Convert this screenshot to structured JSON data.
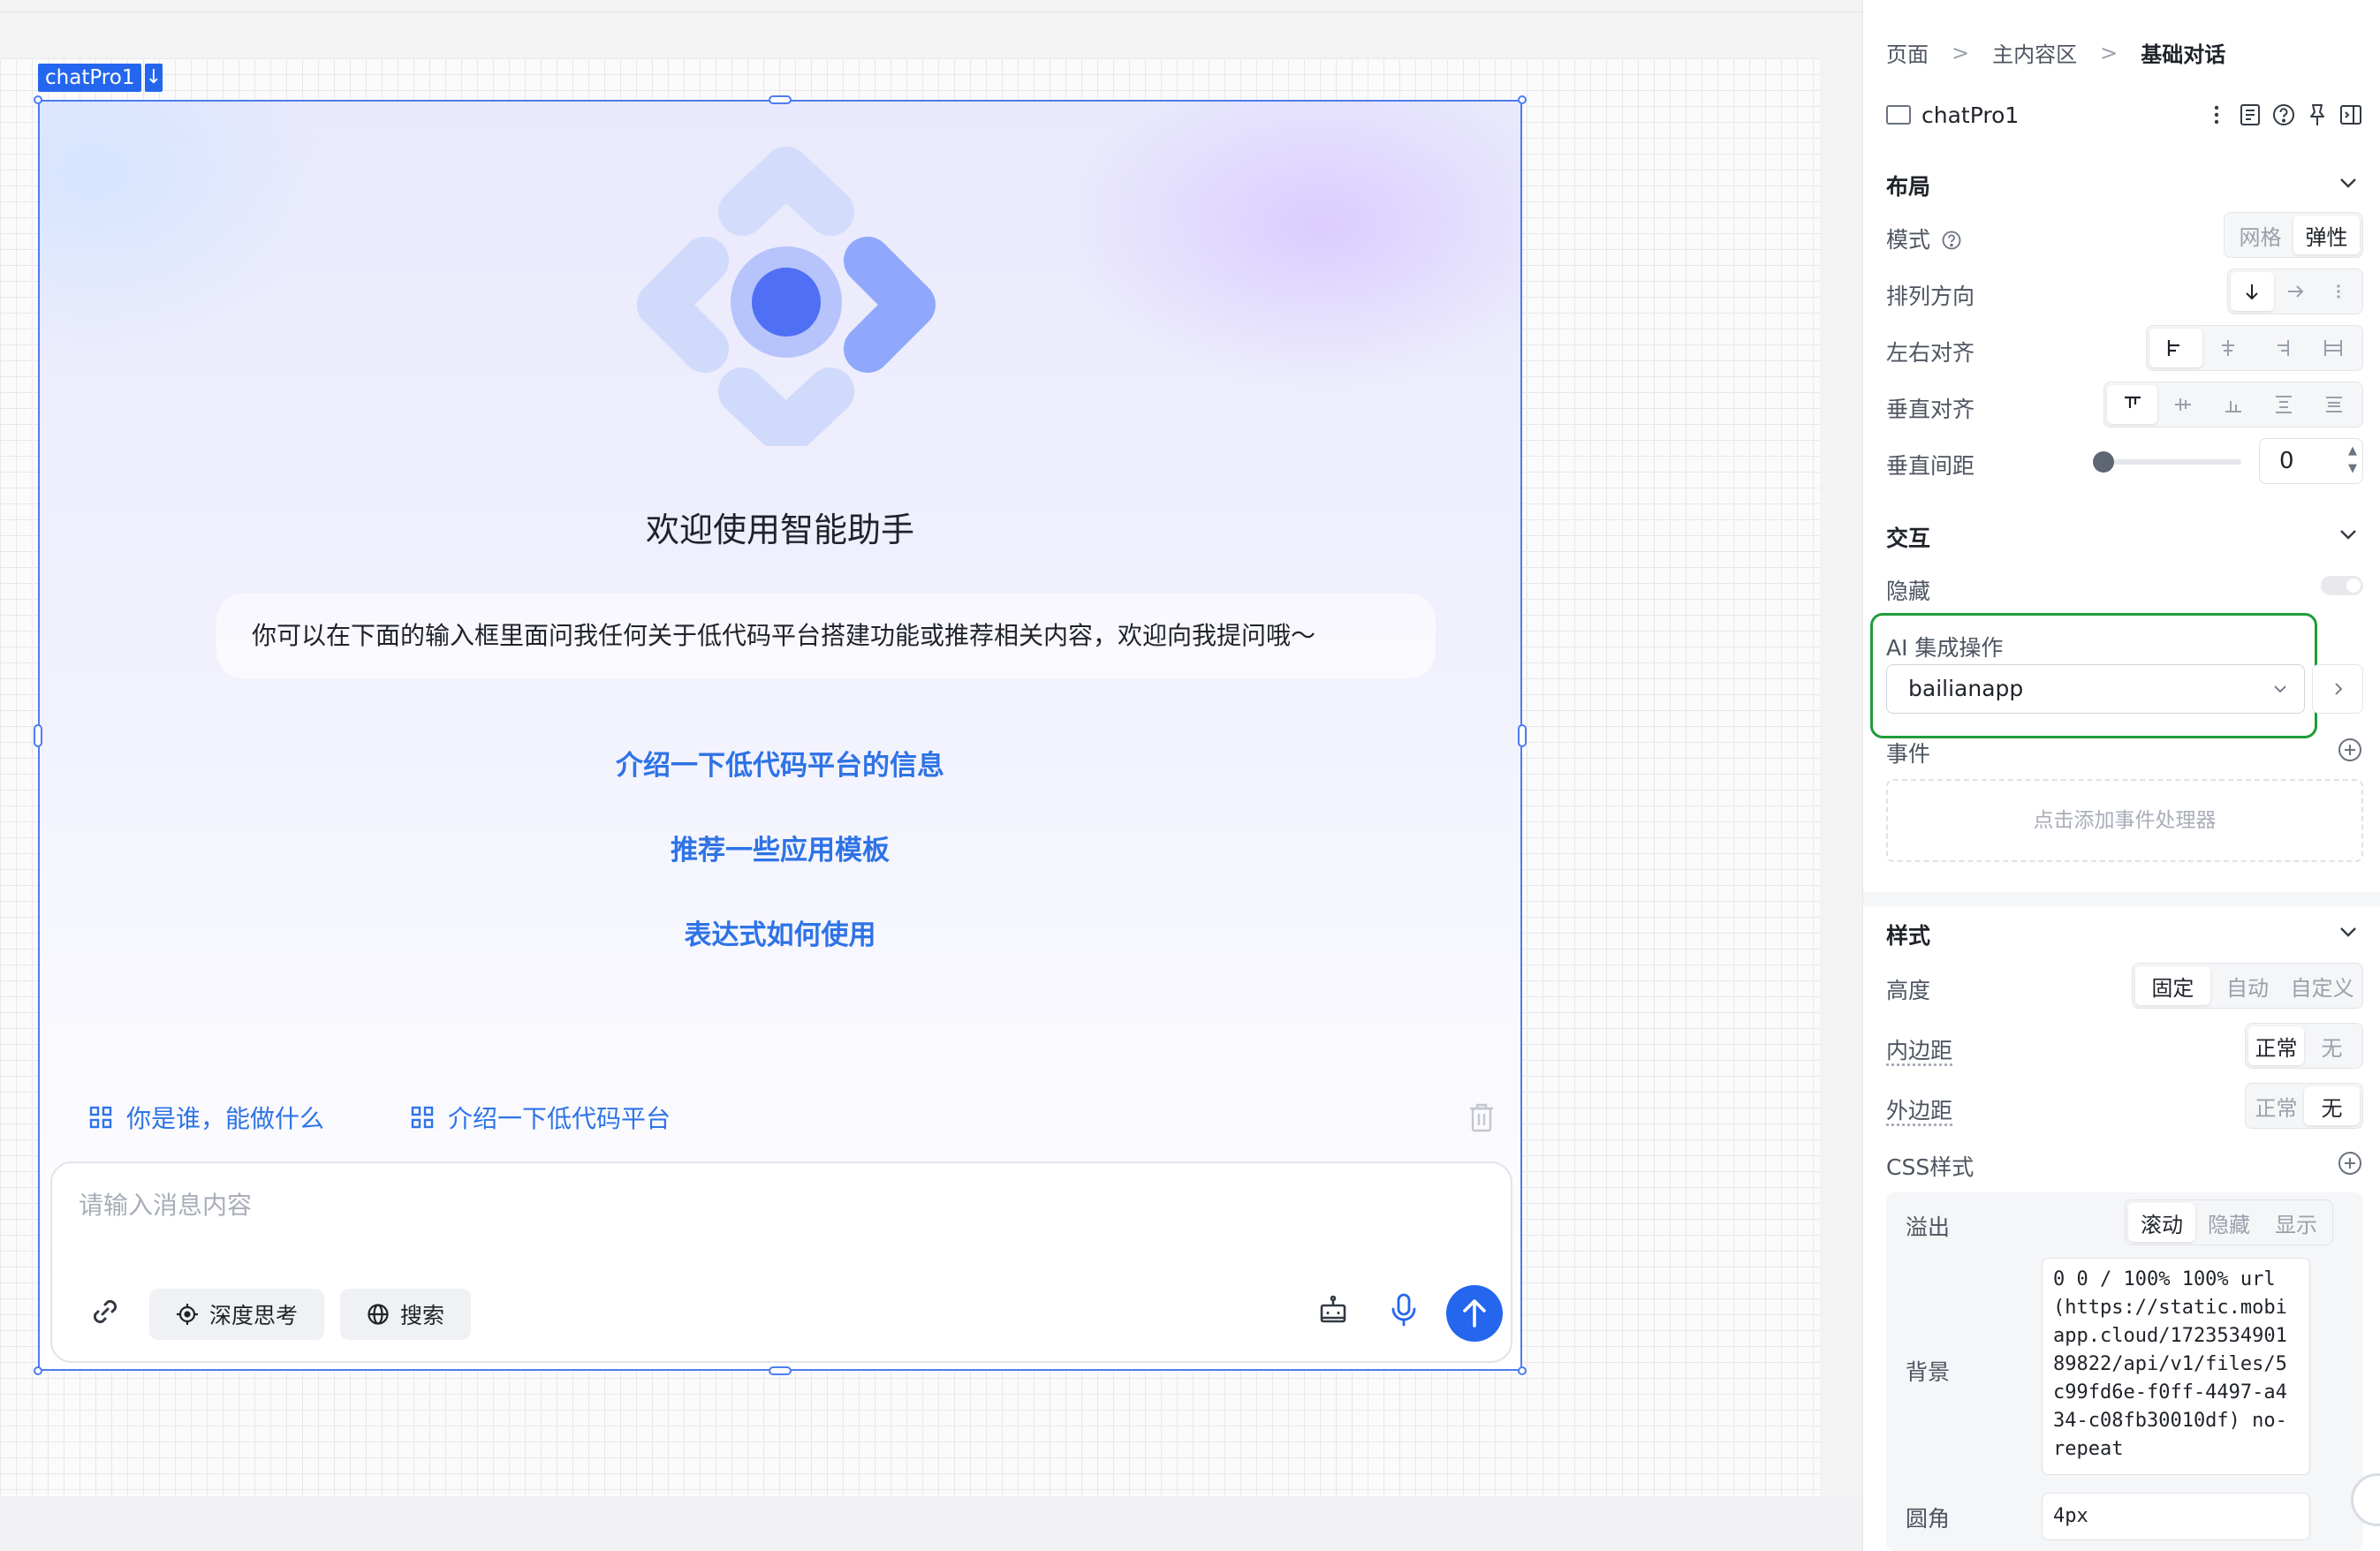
{
  "selection": {
    "component_label": "chatPro1",
    "down_arrow": "↓"
  },
  "chat": {
    "welcome_title": "欢迎使用智能助手",
    "welcome_desc": "你可以在下面的输入框里面问我任何关于低代码平台搭建功能或推荐相关内容，欢迎向我提问哦～",
    "suggestions": [
      "介绍一下低代码平台的信息",
      "推荐一些应用模板",
      "表达式如何使用"
    ],
    "quick_actions": [
      "你是谁，能做什么",
      "介绍一下低代码平台"
    ],
    "input_placeholder": "请输入消息内容",
    "deep_think_label": "深度思考",
    "search_label": "搜索",
    "accent_color": "#2466ee"
  },
  "panel": {
    "breadcrumb": [
      "页面",
      "主内容区",
      "基础对话"
    ],
    "component_name": "chatPro1",
    "layout": {
      "title": "布局",
      "mode_label": "模式",
      "mode_options": [
        "网格",
        "弹性"
      ],
      "mode_selected": "弹性",
      "direction_label": "排列方向",
      "halign_label": "左右对齐",
      "valign_label": "垂直对齐",
      "vgap_label": "垂直间距",
      "vgap_value": "0"
    },
    "interaction": {
      "title": "交互",
      "hidden_label": "隐藏",
      "ai_label": "AI 集成操作",
      "ai_value": "bailianapp",
      "event_label": "事件",
      "event_placeholder": "点击添加事件处理器",
      "highlight_color": "#1f9c3a"
    },
    "style": {
      "title": "样式",
      "height_label": "高度",
      "height_options": [
        "固定",
        "自动",
        "自定义"
      ],
      "padding_label": "内边距",
      "padding_options": [
        "正常",
        "无"
      ],
      "margin_label": "外边距",
      "margin_options": [
        "正常",
        "无"
      ],
      "css_label": "CSS样式",
      "overflow_label": "溢出",
      "overflow_options": [
        "滚动",
        "隐藏",
        "显示"
      ],
      "background_label": "背景",
      "background_value": "0 0 / 100% 100% url(https://static.mobiapp.cloud/172353490189822/api/v1/files/5c99fd6e-f0ff-4497-a434-c08fb30010df) no-repeat",
      "radius_label": "圆角",
      "radius_value": "4px"
    }
  }
}
